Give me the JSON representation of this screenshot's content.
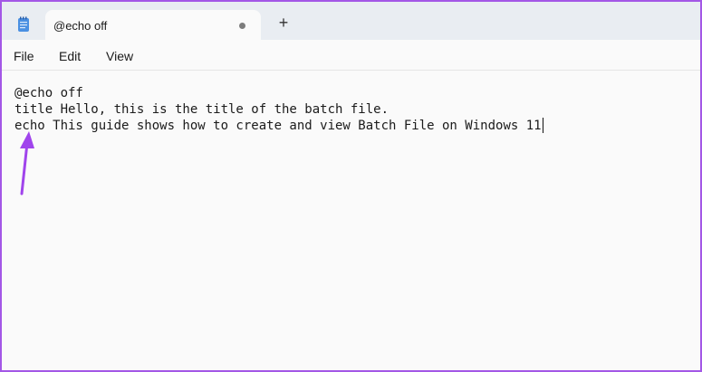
{
  "app": {
    "icon": "notepad-icon"
  },
  "tab": {
    "title": "@echo off",
    "modified_indicator": "unsaved-dot",
    "new_tab_label": "+"
  },
  "menu": {
    "file": "File",
    "edit": "Edit",
    "view": "View"
  },
  "editor": {
    "lines": [
      "@echo off",
      "title Hello, this is the title of the batch file.",
      "echo This guide shows how to create and view Batch File on Windows 11"
    ]
  },
  "colors": {
    "accent": "#a357e6",
    "annotation_arrow": "#a044ec",
    "titlebar_bg": "#e9edf2",
    "editor_bg": "#fafafa"
  }
}
